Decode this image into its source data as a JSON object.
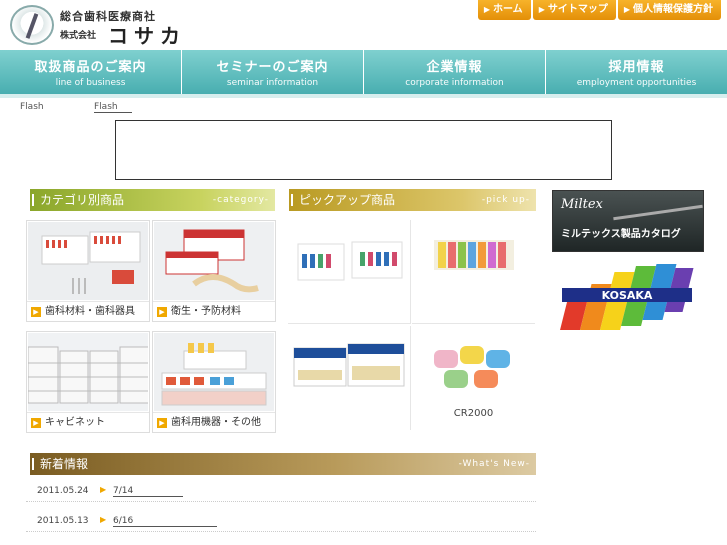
{
  "header": {
    "company_sub": "総合歯科医療商社",
    "company_prefix": "株式会社",
    "company_name": "コサカ",
    "top_links": [
      {
        "label": "ホーム"
      },
      {
        "label": "サイトマップ"
      },
      {
        "label": "個人情報保護方針"
      }
    ]
  },
  "nav": [
    {
      "jp": "取扱商品のご案内",
      "en": "line of business"
    },
    {
      "jp": "セミナーのご案内",
      "en": "seminar information"
    },
    {
      "jp": "企業情報",
      "en": "corporate information"
    },
    {
      "jp": "採用情報",
      "en": "employment opportunities"
    }
  ],
  "flash": {
    "label": "Flash",
    "link": "Flash"
  },
  "category": {
    "title": "カテゴリ別商品",
    "title_en": "-category-",
    "items": [
      {
        "label": "歯科材料・歯科器具"
      },
      {
        "label": "衛生・予防材料"
      },
      {
        "label": "キャビネット"
      },
      {
        "label": "歯科用機器・その他"
      }
    ]
  },
  "pickup": {
    "title": "ピックアップ商品",
    "title_en": "-pick up-",
    "items": [
      {
        "label": ""
      },
      {
        "label": ""
      },
      {
        "label": ""
      },
      {
        "label": "CR2000"
      }
    ]
  },
  "side": {
    "catalog_brand": "Miltex",
    "catalog_caption": "ミルテックス製品カタログ",
    "kosaka_logo_text": "KOSAKA"
  },
  "news": {
    "title": "新着情報",
    "title_en": "-What's New-",
    "items": [
      {
        "date": "2011.05.24",
        "link": "7/14"
      },
      {
        "date": "2011.05.13",
        "link": "6/16"
      }
    ]
  },
  "colors": {
    "nav": "#48aeb0",
    "top_link": "#e48f08",
    "category_head": "#8aa62a",
    "pickup_head": "#b99a22",
    "news_head": "#7a5c22",
    "arrow": "#f0a800"
  }
}
